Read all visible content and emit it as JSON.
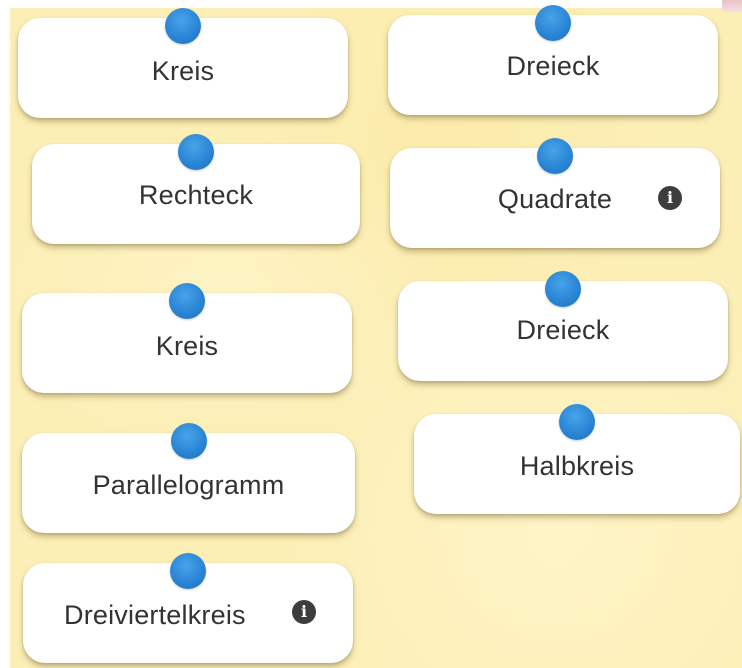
{
  "cards": [
    {
      "label": "Kreis",
      "has_info": false,
      "icon": "handle-dot"
    },
    {
      "label": "Dreieck",
      "has_info": false,
      "icon": "handle-dot"
    },
    {
      "label": "Rechteck",
      "has_info": false,
      "icon": "handle-dot"
    },
    {
      "label": "Quadrate",
      "has_info": true,
      "icon": "handle-dot"
    },
    {
      "label": "Kreis",
      "has_info": false,
      "icon": "handle-dot"
    },
    {
      "label": "Dreieck",
      "has_info": false,
      "icon": "handle-dot"
    },
    {
      "label": "Parallelogramm",
      "has_info": false,
      "icon": "handle-dot"
    },
    {
      "label": "Halbkreis",
      "has_info": false,
      "icon": "handle-dot"
    },
    {
      "label": "Dreiviertelkreis",
      "has_info": true,
      "icon": "handle-dot"
    }
  ],
  "info_glyph": "i",
  "colors": {
    "background": "#fcefb6",
    "card": "#ffffff",
    "dot": "#2a86d6",
    "text": "#333333",
    "info": "#3d3d3d"
  }
}
